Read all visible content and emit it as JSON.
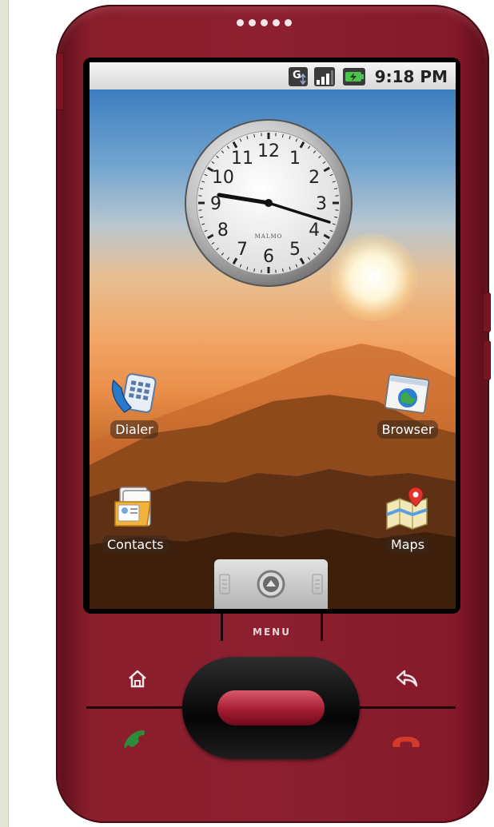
{
  "status_bar": {
    "time": "9:18 PM",
    "network_icon": "network-g-icon",
    "signal_icon": "signal-bars-icon",
    "battery_icon": "battery-charging-icon"
  },
  "clock_widget": {
    "brand": "MALMO",
    "numerals": [
      "12",
      "1",
      "2",
      "3",
      "4",
      "5",
      "6",
      "7",
      "8",
      "9",
      "10",
      "11"
    ],
    "hour_hand_time": "9:18"
  },
  "home_icons": [
    {
      "label": "Dialer",
      "icon": "dialer-icon"
    },
    {
      "label": "Browser",
      "icon": "browser-icon"
    },
    {
      "label": "Contacts",
      "icon": "contacts-icon"
    },
    {
      "label": "Maps",
      "icon": "maps-icon"
    }
  ],
  "hardware": {
    "menu_label": "MENU",
    "home_icon": "home-icon",
    "back_icon": "back-icon",
    "call_icon": "call-icon",
    "end_call_icon": "end-call-icon"
  },
  "colors": {
    "phone_body": "#8c2030",
    "trackball": "#a51d33",
    "call_green": "#2e8b3a",
    "end_red": "#d43a2c"
  }
}
